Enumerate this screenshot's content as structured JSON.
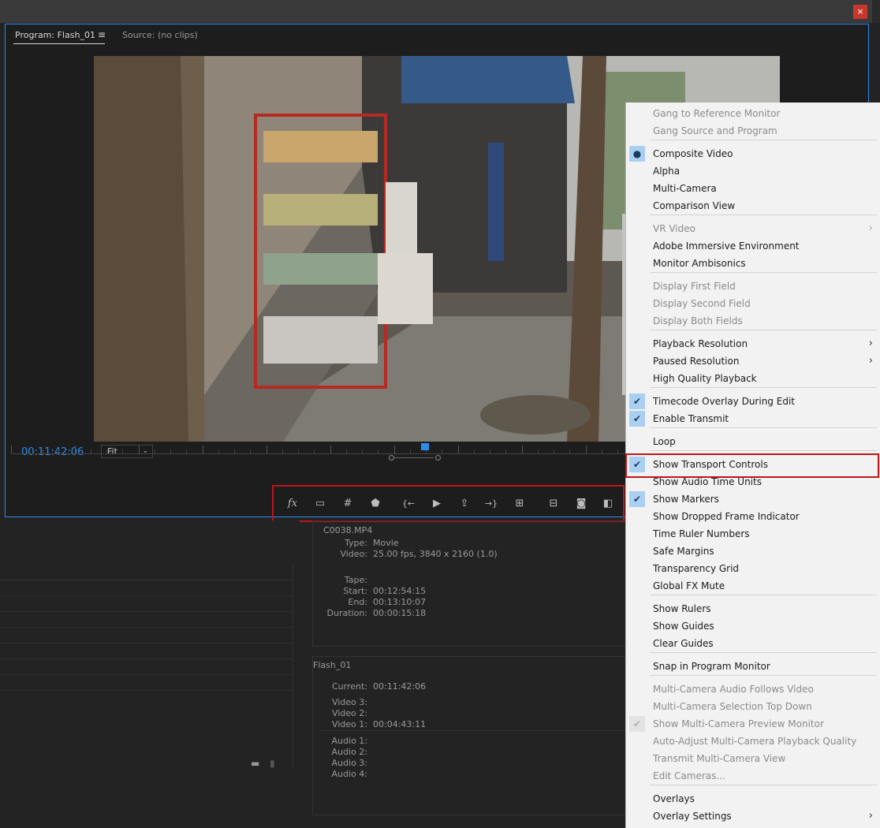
{
  "window": {
    "close_label": "×"
  },
  "monitor": {
    "tab_program": "Program: Flash_01",
    "tab_menu": "≡",
    "tab_source": "Source: (no clips)",
    "timecode": "00:11:42:06",
    "fit_value": "Fit",
    "fit_arrow": "⌄"
  },
  "transport": {
    "buttons": [
      {
        "name": "fx-button",
        "glyph": "fx"
      },
      {
        "name": "safe-margins-button",
        "glyph": "▭"
      },
      {
        "name": "grid-button",
        "glyph": "#"
      },
      {
        "name": "add-marker-button",
        "glyph": "⬟"
      },
      {
        "name": "go-to-in-button",
        "glyph": "{←"
      },
      {
        "name": "play-button",
        "glyph": "▶"
      },
      {
        "name": "lift-button",
        "glyph": "⇪"
      },
      {
        "name": "go-to-out-button",
        "glyph": "→}"
      },
      {
        "name": "insert-button",
        "glyph": "⊞"
      },
      {
        "name": "overwrite-button",
        "glyph": "⊟"
      },
      {
        "name": "export-frame-button",
        "glyph": "◙"
      },
      {
        "name": "comparison-view-button",
        "glyph": "◧"
      }
    ]
  },
  "info": {
    "clip_name": "C0038.MP4",
    "type_label": "Type:",
    "type_value": "Movie",
    "video_label": "Video:",
    "video_value": "25.00 fps, 3840 x 2160 (1.0)",
    "tape_label": "Tape:",
    "start_label": "Start:",
    "start_value": "00:12:54:15",
    "end_label": "End:",
    "end_value": "00:13:10:07",
    "duration_label": "Duration:",
    "duration_value": "00:00:15:18",
    "seq_name": "Flash_01",
    "current_label": "Current:",
    "current_value": "00:11:42:06",
    "video3_label": "Video 3:",
    "video2_label": "Video 2:",
    "video1_label": "Video 1:",
    "video1_value": "00:04:43:11",
    "audio1_label": "Audio 1:",
    "audio2_label": "Audio 2:",
    "audio3_label": "Audio 3:",
    "audio4_label": "Audio 4:"
  },
  "menu": {
    "items": [
      {
        "label": "Gang to Reference Monitor",
        "disabled": true
      },
      {
        "label": "Gang Source and Program",
        "disabled": true
      },
      {
        "label": "Composite Video",
        "mark": "●"
      },
      {
        "label": "Alpha"
      },
      {
        "label": "Multi-Camera"
      },
      {
        "label": "Comparison View"
      },
      {
        "label": "VR Video",
        "disabled": true,
        "submenu": "›"
      },
      {
        "label": "Adobe Immersive Environment"
      },
      {
        "label": "Monitor Ambisonics"
      },
      {
        "label": "Display First Field",
        "disabled": true
      },
      {
        "label": "Display Second Field",
        "disabled": true
      },
      {
        "label": "Display Both Fields",
        "disabled": true
      },
      {
        "label": "Playback Resolution",
        "submenu": "›"
      },
      {
        "label": "Paused Resolution",
        "submenu": "›"
      },
      {
        "label": "High Quality Playback"
      },
      {
        "label": "Timecode Overlay During Edit",
        "mark": "✔"
      },
      {
        "label": "Enable Transmit",
        "mark": "✔"
      },
      {
        "label": "Loop"
      },
      {
        "label": "Show Transport Controls",
        "mark": "✔"
      },
      {
        "label": "Show Audio Time Units"
      },
      {
        "label": "Show Markers",
        "mark": "✔"
      },
      {
        "label": "Show Dropped Frame Indicator"
      },
      {
        "label": "Time Ruler Numbers"
      },
      {
        "label": "Safe Margins"
      },
      {
        "label": "Transparency Grid"
      },
      {
        "label": "Global FX Mute"
      },
      {
        "label": "Show Rulers"
      },
      {
        "label": "Show Guides"
      },
      {
        "label": "Clear Guides"
      },
      {
        "label": "Snap in Program Monitor"
      },
      {
        "label": "Multi-Camera Audio Follows Video",
        "disabled": true
      },
      {
        "label": "Multi-Camera Selection Top Down",
        "disabled": true
      },
      {
        "label": "Show Multi-Camera Preview Monitor",
        "disabled": true,
        "mark": "✔",
        "mark_dim": true
      },
      {
        "label": "Auto-Adjust Multi-Camera Playback Quality",
        "disabled": true
      },
      {
        "label": "Transmit Multi-Camera View",
        "disabled": true
      },
      {
        "label": "Edit Cameras...",
        "disabled": true
      },
      {
        "label": "Overlays"
      },
      {
        "label": "Overlay Settings",
        "submenu": "›"
      }
    ]
  },
  "colors": {
    "accent": "#2d8ceb",
    "highlight": "#c0141a",
    "check_bg": "#a9cff1"
  }
}
